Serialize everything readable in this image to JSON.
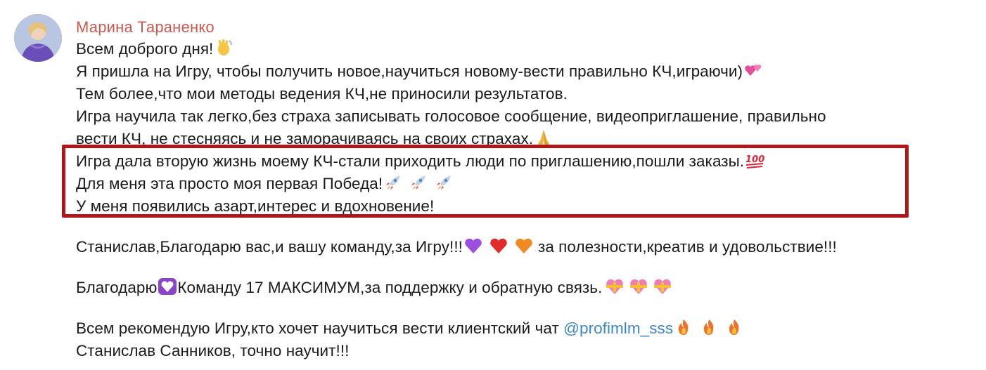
{
  "message": {
    "sender_name": "Марина Тараненко",
    "avatar_icon": "user-avatar",
    "accent_color": "#c75b4f",
    "mention_color": "#3b87c8",
    "highlight_color": "#b0151a",
    "lines": {
      "l1": "Всем доброго дня!",
      "l2": "Я пришла на Игру, чтобы получить новое,научиться новому-вести правильно КЧ,играючи)",
      "l3": "Тем более,что мои методы ведения КЧ,не приносили результатов.",
      "l4": "Игра научила так легко,без страха записывать голосовое сообщение, видеоприглашение, правильно",
      "l5": "вести КЧ, не стесняясь и не заморачиваясь на своих страхах.",
      "l6": "Игра дала вторую жизнь моему КЧ-стали приходить люди по приглашению,пошли заказы.",
      "l7": "Для меня эта просто моя первая Победа!",
      "l8": "У меня появились азарт,интерес и вдохновение!",
      "l9a": "Станислав,Благодарю вас,и вашу команду,за Игру!!!",
      "l9b": "за полезности,креатив и удовольствие!!!",
      "l10a": "Благодарю",
      "l10b": "Команду 17 МАКСИМУМ,за поддержку и обратную связь.",
      "l11a": "Всем рекомендую Игру,кто хочет научиться вести клиентский чат ",
      "l11_mention": "@profimlm_sss",
      "l12": "Станислав Санников, точно научит!!!"
    }
  }
}
